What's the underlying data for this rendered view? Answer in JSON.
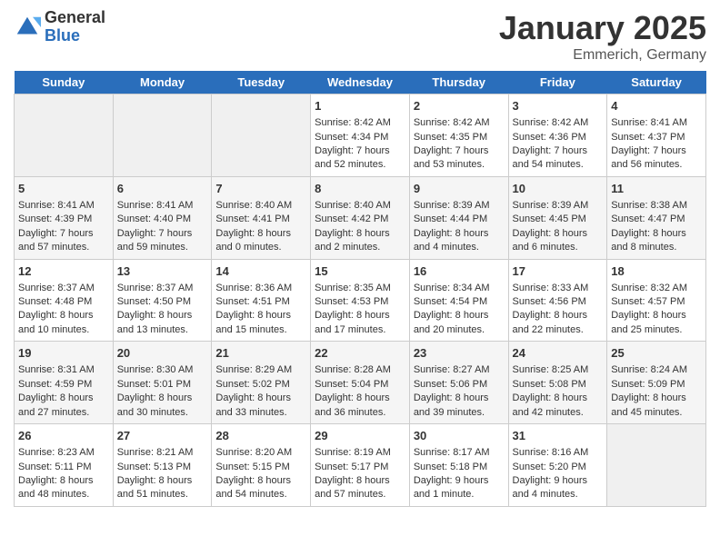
{
  "header": {
    "logo_general": "General",
    "logo_blue": "Blue",
    "title": "January 2025",
    "location": "Emmerich, Germany"
  },
  "days_of_week": [
    "Sunday",
    "Monday",
    "Tuesday",
    "Wednesday",
    "Thursday",
    "Friday",
    "Saturday"
  ],
  "weeks": [
    [
      {
        "day": "",
        "content": ""
      },
      {
        "day": "",
        "content": ""
      },
      {
        "day": "",
        "content": ""
      },
      {
        "day": "1",
        "content": "Sunrise: 8:42 AM\nSunset: 4:34 PM\nDaylight: 7 hours and 52 minutes."
      },
      {
        "day": "2",
        "content": "Sunrise: 8:42 AM\nSunset: 4:35 PM\nDaylight: 7 hours and 53 minutes."
      },
      {
        "day": "3",
        "content": "Sunrise: 8:42 AM\nSunset: 4:36 PM\nDaylight: 7 hours and 54 minutes."
      },
      {
        "day": "4",
        "content": "Sunrise: 8:41 AM\nSunset: 4:37 PM\nDaylight: 7 hours and 56 minutes."
      }
    ],
    [
      {
        "day": "5",
        "content": "Sunrise: 8:41 AM\nSunset: 4:39 PM\nDaylight: 7 hours and 57 minutes."
      },
      {
        "day": "6",
        "content": "Sunrise: 8:41 AM\nSunset: 4:40 PM\nDaylight: 7 hours and 59 minutes."
      },
      {
        "day": "7",
        "content": "Sunrise: 8:40 AM\nSunset: 4:41 PM\nDaylight: 8 hours and 0 minutes."
      },
      {
        "day": "8",
        "content": "Sunrise: 8:40 AM\nSunset: 4:42 PM\nDaylight: 8 hours and 2 minutes."
      },
      {
        "day": "9",
        "content": "Sunrise: 8:39 AM\nSunset: 4:44 PM\nDaylight: 8 hours and 4 minutes."
      },
      {
        "day": "10",
        "content": "Sunrise: 8:39 AM\nSunset: 4:45 PM\nDaylight: 8 hours and 6 minutes."
      },
      {
        "day": "11",
        "content": "Sunrise: 8:38 AM\nSunset: 4:47 PM\nDaylight: 8 hours and 8 minutes."
      }
    ],
    [
      {
        "day": "12",
        "content": "Sunrise: 8:37 AM\nSunset: 4:48 PM\nDaylight: 8 hours and 10 minutes."
      },
      {
        "day": "13",
        "content": "Sunrise: 8:37 AM\nSunset: 4:50 PM\nDaylight: 8 hours and 13 minutes."
      },
      {
        "day": "14",
        "content": "Sunrise: 8:36 AM\nSunset: 4:51 PM\nDaylight: 8 hours and 15 minutes."
      },
      {
        "day": "15",
        "content": "Sunrise: 8:35 AM\nSunset: 4:53 PM\nDaylight: 8 hours and 17 minutes."
      },
      {
        "day": "16",
        "content": "Sunrise: 8:34 AM\nSunset: 4:54 PM\nDaylight: 8 hours and 20 minutes."
      },
      {
        "day": "17",
        "content": "Sunrise: 8:33 AM\nSunset: 4:56 PM\nDaylight: 8 hours and 22 minutes."
      },
      {
        "day": "18",
        "content": "Sunrise: 8:32 AM\nSunset: 4:57 PM\nDaylight: 8 hours and 25 minutes."
      }
    ],
    [
      {
        "day": "19",
        "content": "Sunrise: 8:31 AM\nSunset: 4:59 PM\nDaylight: 8 hours and 27 minutes."
      },
      {
        "day": "20",
        "content": "Sunrise: 8:30 AM\nSunset: 5:01 PM\nDaylight: 8 hours and 30 minutes."
      },
      {
        "day": "21",
        "content": "Sunrise: 8:29 AM\nSunset: 5:02 PM\nDaylight: 8 hours and 33 minutes."
      },
      {
        "day": "22",
        "content": "Sunrise: 8:28 AM\nSunset: 5:04 PM\nDaylight: 8 hours and 36 minutes."
      },
      {
        "day": "23",
        "content": "Sunrise: 8:27 AM\nSunset: 5:06 PM\nDaylight: 8 hours and 39 minutes."
      },
      {
        "day": "24",
        "content": "Sunrise: 8:25 AM\nSunset: 5:08 PM\nDaylight: 8 hours and 42 minutes."
      },
      {
        "day": "25",
        "content": "Sunrise: 8:24 AM\nSunset: 5:09 PM\nDaylight: 8 hours and 45 minutes."
      }
    ],
    [
      {
        "day": "26",
        "content": "Sunrise: 8:23 AM\nSunset: 5:11 PM\nDaylight: 8 hours and 48 minutes."
      },
      {
        "day": "27",
        "content": "Sunrise: 8:21 AM\nSunset: 5:13 PM\nDaylight: 8 hours and 51 minutes."
      },
      {
        "day": "28",
        "content": "Sunrise: 8:20 AM\nSunset: 5:15 PM\nDaylight: 8 hours and 54 minutes."
      },
      {
        "day": "29",
        "content": "Sunrise: 8:19 AM\nSunset: 5:17 PM\nDaylight: 8 hours and 57 minutes."
      },
      {
        "day": "30",
        "content": "Sunrise: 8:17 AM\nSunset: 5:18 PM\nDaylight: 9 hours and 1 minute."
      },
      {
        "day": "31",
        "content": "Sunrise: 8:16 AM\nSunset: 5:20 PM\nDaylight: 9 hours and 4 minutes."
      },
      {
        "day": "",
        "content": ""
      }
    ]
  ]
}
